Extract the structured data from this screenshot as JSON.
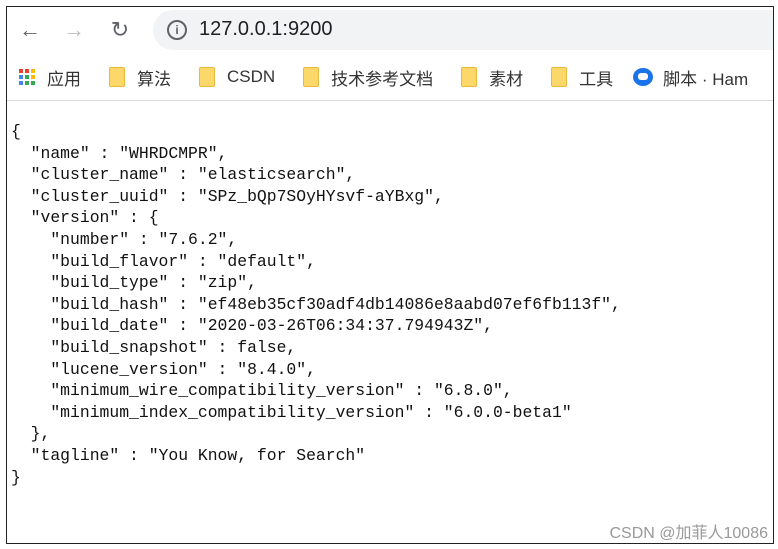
{
  "browser": {
    "url": "127.0.0.1:9200",
    "bookmarks": [
      {
        "label": "应用",
        "icon": "apps-grid-icon"
      },
      {
        "label": "算法",
        "icon": "folder-icon"
      },
      {
        "label": "CSDN",
        "icon": "folder-icon"
      },
      {
        "label": "技术参考文档",
        "icon": "folder-icon"
      },
      {
        "label": "素材",
        "icon": "folder-icon"
      },
      {
        "label": "工具",
        "icon": "folder-icon"
      },
      {
        "label": "脚本 · Ham",
        "icon": "tampermonkey-icon"
      }
    ]
  },
  "json_lines": [
    "{",
    "  \"name\" : \"WHRDCMPR\",",
    "  \"cluster_name\" : \"elasticsearch\",",
    "  \"cluster_uuid\" : \"SPz_bQp7SOyHYsvf-aYBxg\",",
    "  \"version\" : {",
    "    \"number\" : \"7.6.2\",",
    "    \"build_flavor\" : \"default\",",
    "    \"build_type\" : \"zip\",",
    "    \"build_hash\" : \"ef48eb35cf30adf4db14086e8aabd07ef6fb113f\",",
    "    \"build_date\" : \"2020-03-26T06:34:37.794943Z\",",
    "    \"build_snapshot\" : false,",
    "    \"lucene_version\" : \"8.4.0\",",
    "    \"minimum_wire_compatibility_version\" : \"6.8.0\",",
    "    \"minimum_index_compatibility_version\" : \"6.0.0-beta1\"",
    "  },",
    "  \"tagline\" : \"You Know, for Search\"",
    "}"
  ],
  "watermark": "CSDN @加菲人10086"
}
